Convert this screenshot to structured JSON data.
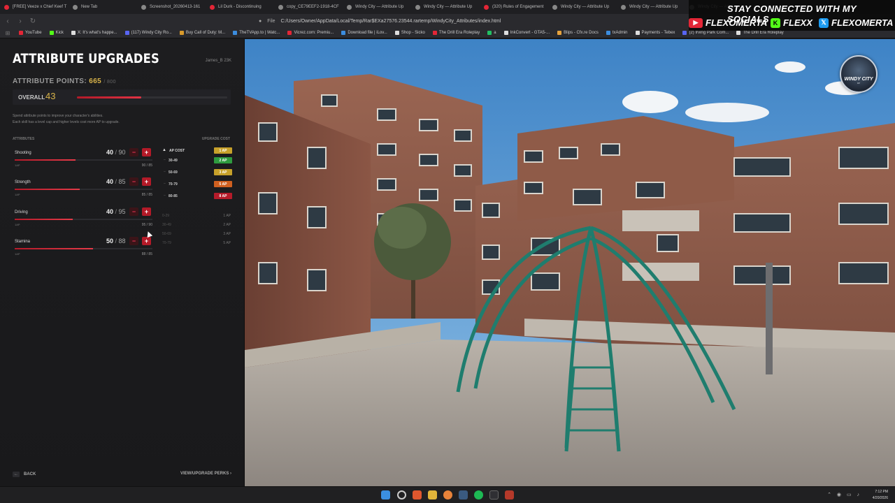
{
  "browser": {
    "tabs": [
      {
        "label": "[FREE] Veeze x Chief Keef T",
        "color": "#e32636"
      },
      {
        "label": "New Tab",
        "color": "#888888"
      },
      {
        "label": "Screenshot_20260413-161",
        "color": "#888888"
      },
      {
        "label": "Lil Durk - Discontinuing",
        "color": "#e32636"
      },
      {
        "label": "copy_CE79EEF2-1918-4CF",
        "color": "#888888"
      },
      {
        "label": "Windy City — Attribute Up",
        "color": "#888888"
      },
      {
        "label": "Windy City — Attribute Up",
        "color": "#888888"
      },
      {
        "label": "(320) Rules of Engagement",
        "color": "#e32636"
      },
      {
        "label": "Windy City — Attribute Up",
        "color": "#888888"
      },
      {
        "label": "Windy City — Attribute Up",
        "color": "#888888"
      },
      {
        "label": "Windy City — Attrib",
        "color": "#888888"
      }
    ],
    "address": {
      "scheme": "File",
      "url": "C:/Users/Owner/AppData/Local/Temp/Rar$EXa27576.23544.rartemp/WindyCity_Attributes/index.html"
    },
    "bookmarks": [
      {
        "label": "YouTube",
        "color": "#e32636"
      },
      {
        "label": "Kick",
        "color": "#53fc18"
      },
      {
        "label": "X: It's what's happe...",
        "color": "#dddddd"
      },
      {
        "label": "(117) Windy City Ro...",
        "color": "#5865f2"
      },
      {
        "label": "Buy Call of Duty: M...",
        "color": "#d99a2b"
      },
      {
        "label": "TheTVApp.to | Watc...",
        "color": "#3c8dde"
      },
      {
        "label": "Vicrez.com: Premiu...",
        "color": "#e32636"
      },
      {
        "label": "Download file | iLov...",
        "color": "#3c8dde"
      },
      {
        "label": "Shop - Sicko",
        "color": "#dddddd"
      },
      {
        "label": "The Drill Era Roleplay",
        "color": "#e32636"
      },
      {
        "label": "a",
        "color": "#21c063"
      },
      {
        "label": "InkConvert - GTA5-...",
        "color": "#dddddd"
      },
      {
        "label": "Blips - Cfx.re Docs",
        "color": "#e6a23c"
      },
      {
        "label": "txAdmin",
        "color": "#3c8dde"
      },
      {
        "label": "Payments - Tebex",
        "color": "#dddddd"
      },
      {
        "label": "(2) Irving Park Com...",
        "color": "#5865f2"
      },
      {
        "label": "The Drill Era Roleplay",
        "color": "#dddddd"
      }
    ]
  },
  "socials": {
    "title": "STAY CONNECTED WITH MY SOCIALS",
    "youtube": "FLEXOMERTA",
    "kick": "FLEXX",
    "x": "FLEXOMERTA"
  },
  "panel": {
    "title": "ATTRIBUTE UPGRADES",
    "player": "James_B   23K",
    "points_label": "ATTRIBUTE POINTS:",
    "points_current": "665",
    "points_max": "/ 800",
    "overall_label": "OVERALL",
    "overall_value": "43",
    "overall_fill": 0.43,
    "desc_line1": "Spend attribute points to improve your character's abilities.",
    "desc_line2": "Each skill has a level cap and higher levels cost more AP to upgrade.",
    "col_attributes": "ATTRIBUTES",
    "col_upgrade_cost": "UPGRADE COST",
    "attributes": [
      {
        "name": "Shooting",
        "value": "40",
        "cap": "90",
        "fill": 0.44,
        "ap": "1AP",
        "cost": "90 / 85"
      },
      {
        "name": "Strength",
        "value": "40",
        "cap": "85",
        "fill": 0.47,
        "ap": "1AP",
        "cost": "85 / 85"
      },
      {
        "name": "Driving",
        "value": "40",
        "cap": "95",
        "fill": 0.42,
        "ap": "1AP",
        "cost": "95 / 90"
      },
      {
        "name": "Stamina",
        "value": "50",
        "cap": "88",
        "fill": 0.57,
        "ap": "1AP",
        "cost": "88 / 85"
      }
    ],
    "cost_table": {
      "header": "AP COST",
      "header_badge": "1 AP",
      "rows": [
        {
          "range": "30-49",
          "badge": "2 AP",
          "color": "#2e9b3f"
        },
        {
          "range": "50-69",
          "badge": "3 AP",
          "color": "#c7a12a"
        },
        {
          "range": "70-79",
          "badge": "5 AP",
          "color": "#d06020"
        },
        {
          "range": "80-85",
          "badge": "8 AP",
          "color": "#b51b2a"
        }
      ]
    },
    "mini_table": [
      {
        "range": "0-29",
        "ap": "1 AP"
      },
      {
        "range": "30-49",
        "ap": "2 AP"
      },
      {
        "range": "50-69",
        "ap": "3 AP"
      },
      {
        "range": "70-79",
        "ap": "5 AP"
      }
    ],
    "back_label": "BACK",
    "perks_label": "VIEW/UPGRADE PERKS ›"
  },
  "logo": {
    "line1": "WINDY CITY",
    "line2": "RP"
  },
  "taskbar": {
    "time": "7:12 PM",
    "date": "4/20/2026"
  },
  "colors": {
    "accent": "#b51b2a",
    "gold": "#d9b44a"
  }
}
